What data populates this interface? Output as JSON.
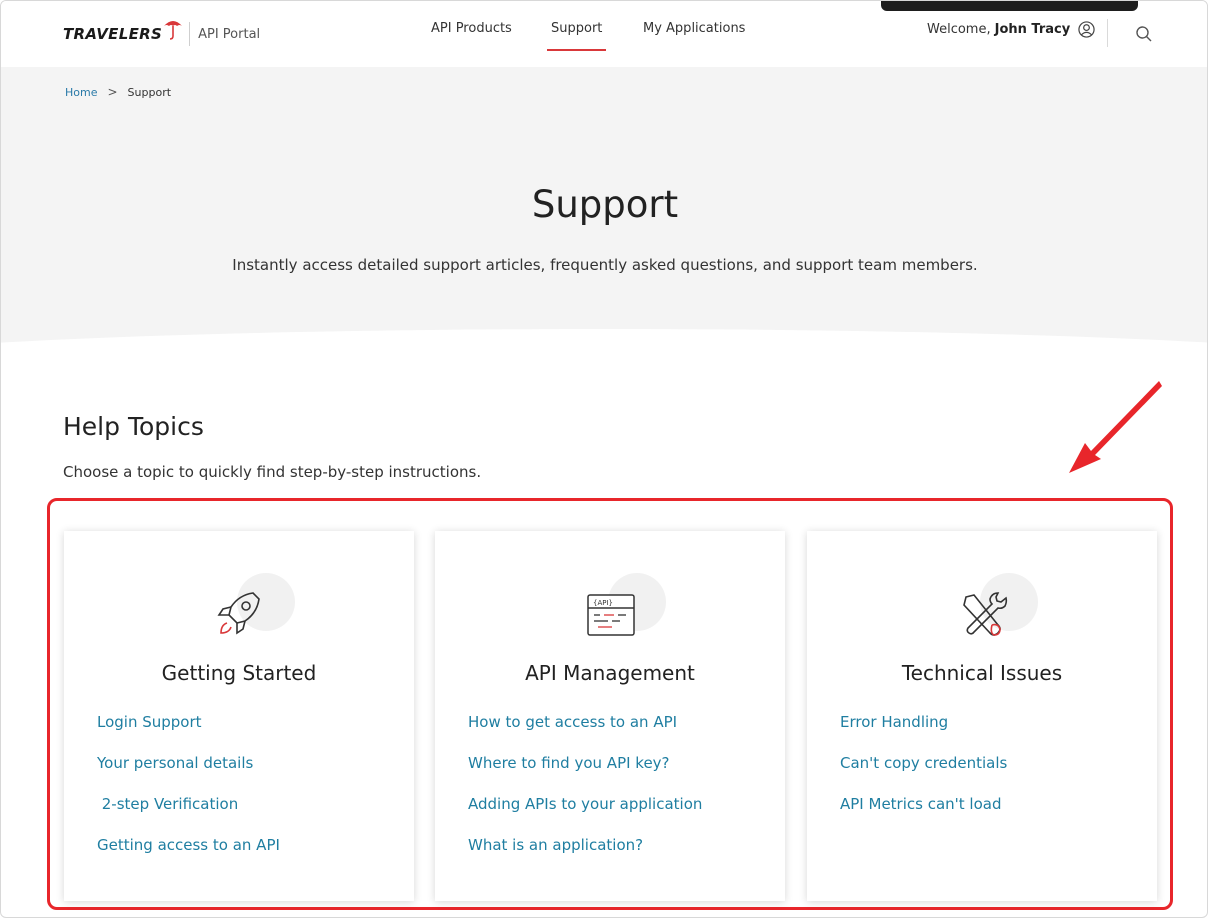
{
  "header": {
    "logo_text": "TRAVELERS",
    "portal_label": "API Portal",
    "nav": [
      {
        "label": "API Products"
      },
      {
        "label": "Support",
        "active": true
      },
      {
        "label": "My Applications"
      }
    ],
    "welcome_prefix": "Welcome,",
    "user_name": "John Tracy",
    "icons": {
      "user": "user-circle-icon",
      "search": "search-icon",
      "logo": "umbrella-icon"
    }
  },
  "breadcrumb": {
    "home": "Home",
    "separator": ">",
    "current": "Support"
  },
  "hero": {
    "title": "Support",
    "subtitle": "Instantly access detailed support articles, frequently asked questions, and support team members."
  },
  "help_topics": {
    "title": "Help Topics",
    "subtitle": "Choose a topic to quickly find step-by-step instructions.",
    "cards": [
      {
        "title": "Getting Started",
        "icon": "rocket-icon",
        "links": [
          "Login Support",
          "Your personal details",
          " 2-step Verification",
          "Getting access to an API"
        ]
      },
      {
        "title": "API Management",
        "icon": "api-window-icon",
        "icon_text": "{API}",
        "links": [
          "How to get access to an API",
          "Where to find you API key?",
          "Adding APIs to your application",
          "What is an application?"
        ]
      },
      {
        "title": "Technical Issues",
        "icon": "wrench-screwdriver-icon",
        "links": [
          "Error Handling",
          "Can't copy credentials",
          "API Metrics can't load"
        ]
      }
    ]
  },
  "colors": {
    "accent_red": "#d9383a",
    "link_blue": "#1f7ea1",
    "annotation_red": "#e8262b",
    "hero_bg": "#f4f4f4"
  }
}
